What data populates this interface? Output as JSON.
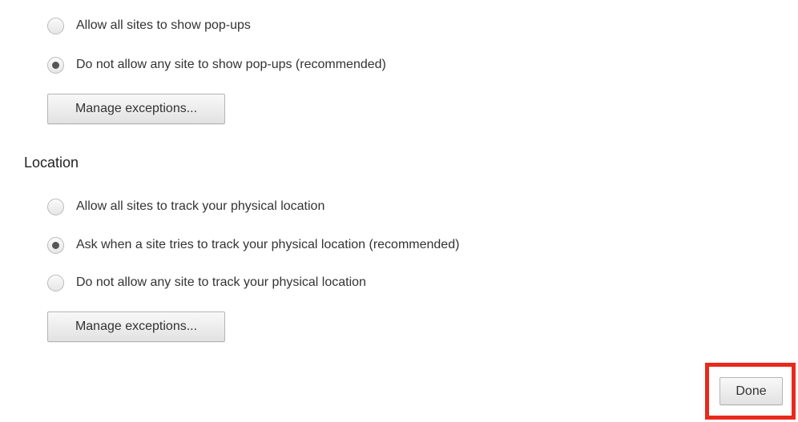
{
  "popups": {
    "options": [
      {
        "label": "Allow all sites to show pop-ups",
        "checked": false
      },
      {
        "label": "Do not allow any site to show pop-ups (recommended)",
        "checked": true
      }
    ],
    "manage_label": "Manage exceptions..."
  },
  "location": {
    "heading": "Location",
    "options": [
      {
        "label": "Allow all sites to track your physical location",
        "checked": false
      },
      {
        "label": "Ask when a site tries to track your physical location (recommended)",
        "checked": true
      },
      {
        "label": "Do not allow any site to track your physical location",
        "checked": false
      }
    ],
    "manage_label": "Manage exceptions..."
  },
  "footer": {
    "done_label": "Done",
    "highlight_color": "#e8291c"
  }
}
